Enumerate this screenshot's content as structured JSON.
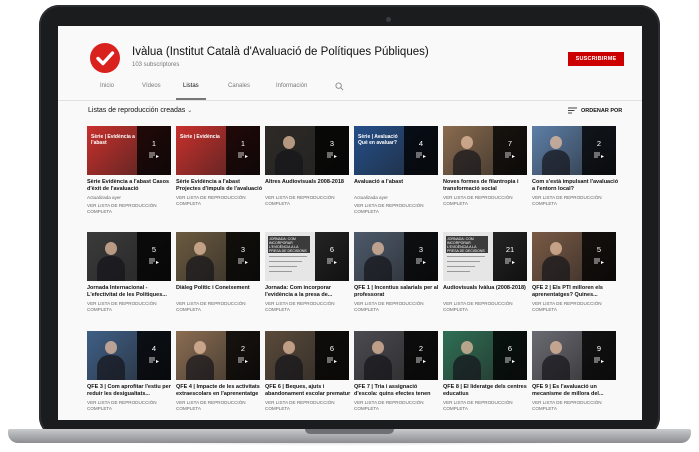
{
  "channel": {
    "name": "Ivàlua (Institut Català d'Avaluació de Polítiques Públiques)",
    "subscribers": "103 subscriptores",
    "subscribe_label": "SUSCRIBIRME",
    "brand_color": "#d9211e"
  },
  "tabs": [
    {
      "label": "Inicio"
    },
    {
      "label": "Vídeos"
    },
    {
      "label": "Listas",
      "active": true
    },
    {
      "label": "Canales"
    },
    {
      "label": "Información"
    }
  ],
  "section": {
    "title": "Listas de reproducción creadas",
    "sort_label": "ORDENAR POR"
  },
  "playlists": [
    {
      "title": "Sèrie Evidència a l'abast Casos d'èxit de l'avaluació",
      "count": "1",
      "meta": "Actualizada ayer",
      "link": "VER LISTA DE REPRODUCCIÓN COMPLETA",
      "thumb_color": "#c9302c",
      "banner": "Sèrie | Evidència a l'abast"
    },
    {
      "title": "Sèrie Evidència a l'abast Projectes d'impuls de l'avaluació",
      "count": "1",
      "meta": "",
      "link": "VER LISTA DE REPRODUCCIÓN COMPLETA",
      "thumb_color": "#c9302c",
      "banner": "Sèrie | Evidència"
    },
    {
      "title": "Altres Audiovisuals 2008-2018",
      "count": "3",
      "meta": "",
      "link": "VER LISTA DE REPRODUCCIÓN COMPLETA",
      "thumb_color": "#2d2a26"
    },
    {
      "title": "Avaluació a l'abast",
      "count": "4",
      "meta": "Actualizada ayer",
      "link": "VER LISTA DE REPRODUCCIÓN COMPLETA",
      "thumb_color": "#244f8a",
      "banner": "Sèrie | Avaluació Què en avaluar?"
    },
    {
      "title": "Noves formes de filantropia i transformació social",
      "count": "7",
      "meta": "",
      "link": "VER LISTA DE REPRODUCCIÓN COMPLETA",
      "thumb_color": "#8a6b4f"
    },
    {
      "title": "Com s'està impulsant l'avaluació a l'entorn local?",
      "count": "2",
      "meta": "",
      "link": "VER LISTA DE REPRODUCCIÓN COMPLETA",
      "thumb_color": "#5d7fa8"
    },
    {
      "title": "Jornada Internacional - L'efectivitat de les Polítiques...",
      "count": "5",
      "meta": "",
      "link": "VER LISTA DE REPRODUCCIÓN COMPLETA",
      "thumb_color": "#3a3a3a"
    },
    {
      "title": "Diàleg Polític i Coneixement",
      "count": "3",
      "meta": "",
      "link": "VER LISTA DE REPRODUCCIÓN COMPLETA",
      "thumb_color": "#6b5a40"
    },
    {
      "title": "Jornada: Com incorporar l'evidència a la presa de...",
      "count": "6",
      "meta": "",
      "link": "VER LISTA DE REPRODUCCIÓN COMPLETA",
      "thumb_color": "#dcdcdc",
      "banner": "JORNADA: COM INCORPORAR L'EVIDÈNCIA A LA PRESA DE DECISIONS"
    },
    {
      "title": "QFE 1 | Incentius salarials per al professorat",
      "count": "3",
      "meta": "",
      "link": "VER LISTA DE REPRODUCCIÓN COMPLETA",
      "thumb_color": "#4d5a6b"
    },
    {
      "title": "Audiovisuals Ivàlua (2008-2018)",
      "count": "21",
      "meta": "",
      "link": "VER LISTA DE REPRODUCCIÓN COMPLETA",
      "thumb_color": "#dcdcdc",
      "banner": "JORNADA: COM INCORPORAR L'EVIDÈNCIA A LA PRESA DE DECISIONS"
    },
    {
      "title": "QFE 2 | Els PTI milloren els aprenentatges? Quines...",
      "count": "5",
      "meta": "",
      "link": "VER LISTA DE REPRODUCCIÓN COMPLETA",
      "thumb_color": "#7a5a45"
    },
    {
      "title": "QFE 3 | Com aprofitar l'estiu per reduir les desigualtats...",
      "count": "4",
      "meta": "",
      "link": "VER LISTA DE REPRODUCCIÓN COMPLETA",
      "thumb_color": "#3f5f86"
    },
    {
      "title": "QFE 4 | Impacte de les activitats extraescolars en l'aprenentatge",
      "count": "2",
      "meta": "",
      "link": "VER LISTA DE REPRODUCCIÓN COMPLETA",
      "thumb_color": "#8b6d52"
    },
    {
      "title": "QFE 6 | Beques, ajuts i abandonament escolar prematur",
      "count": "6",
      "meta": "",
      "link": "VER LISTA DE REPRODUCCIÓN COMPLETA",
      "thumb_color": "#5a4a3a"
    },
    {
      "title": "QFE 7 | Tria i assignació d'escola: quins efectes tenen sobre la...",
      "count": "2",
      "meta": "",
      "link": "VER LISTA DE REPRODUCCIÓN COMPLETA",
      "thumb_color": "#4a4a50"
    },
    {
      "title": "QFE 8 | El lideratge dels centres educatius",
      "count": "6",
      "meta": "",
      "link": "VER LISTA DE REPRODUCCIÓN COMPLETA",
      "thumb_color": "#2f6f55"
    },
    {
      "title": "QFE 9 | És l'avaluació un mecanisme de millora del...",
      "count": "9",
      "meta": "",
      "link": "VER LISTA DE REPRODUCCIÓN COMPLETA",
      "thumb_color": "#6a6a72"
    }
  ]
}
